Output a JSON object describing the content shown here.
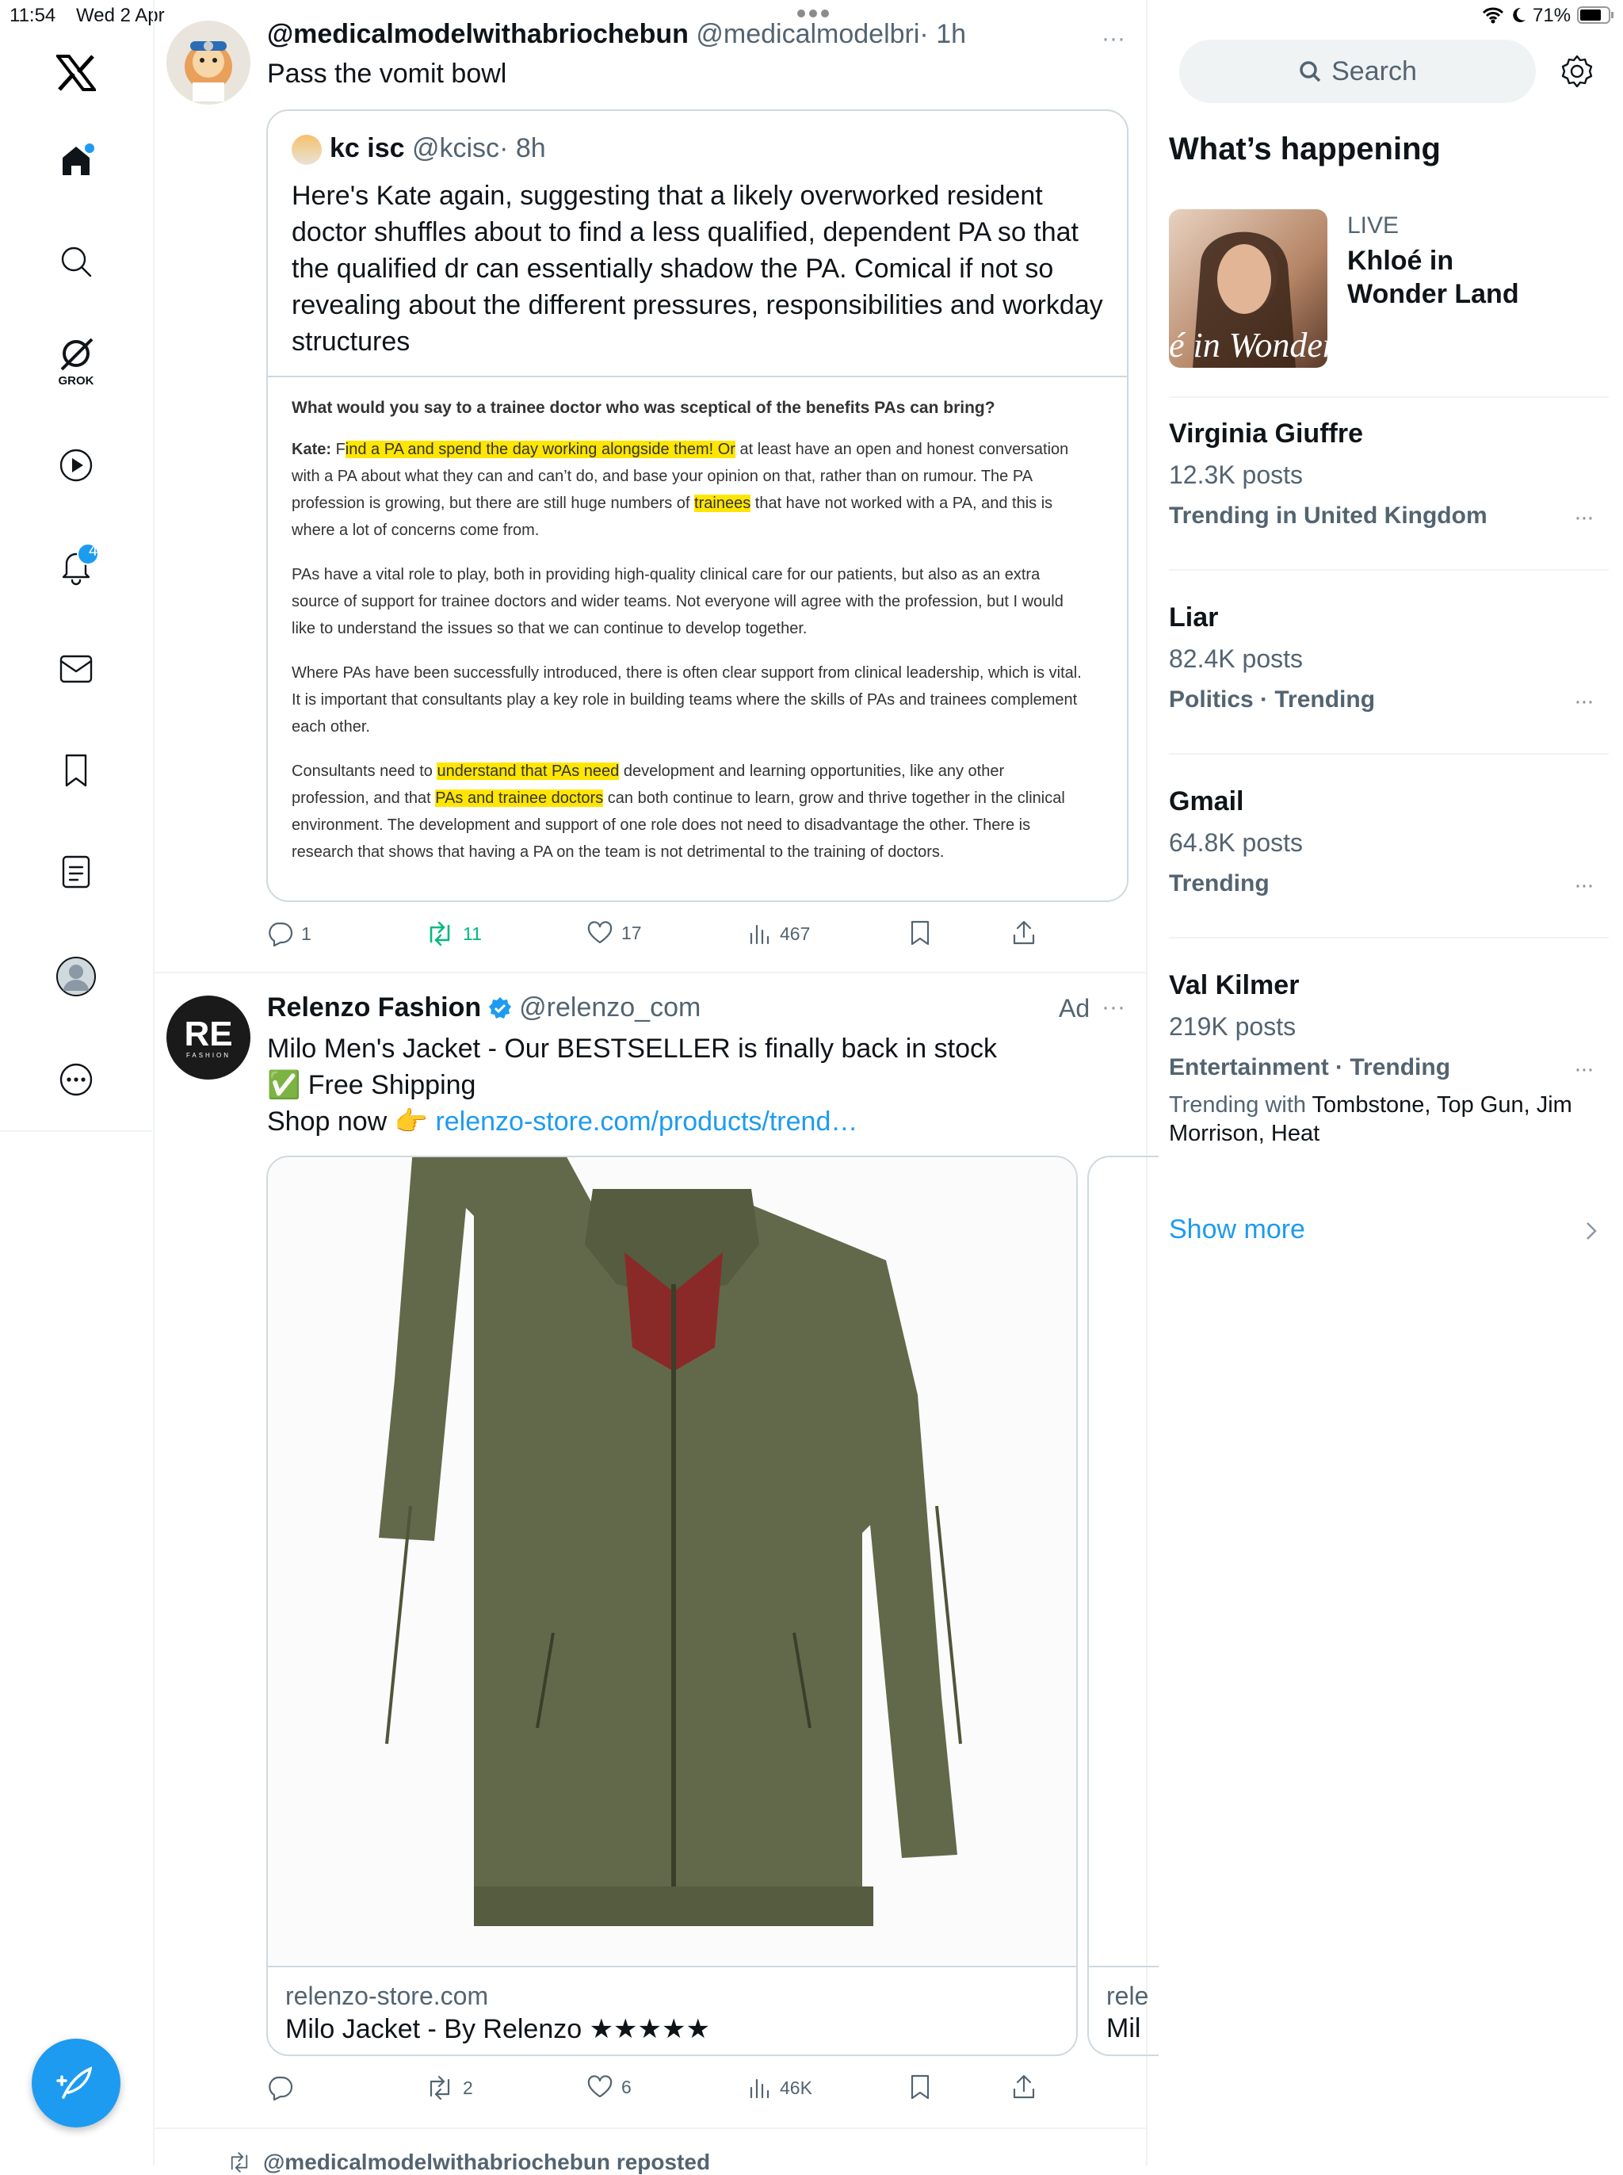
{
  "status": {
    "time": "11:54",
    "date": "Wed 2 Apr",
    "battery": "71%"
  },
  "nav": {
    "grok_label": "GROK",
    "notif_count": "4"
  },
  "tweet1": {
    "name": "@medicalmodelwithabriochebun",
    "handle": "@medicalmodelbri",
    "time": "· 1h",
    "text": "Pass the vomit bowl",
    "quote": {
      "name": "kc isc",
      "handle": "@kcisc",
      "time": "· 8h",
      "text": "Here's Kate again, suggesting that a likely overworked  resident doctor shuffles about to find a less qualified, dependent PA so that the qualified dr can essentially shadow the PA. Comical if not so revealing about the different pressures, responsibilities and workday structures",
      "doc": {
        "question": "What would you say to a trainee doctor who was sceptical of the benefits PAs can bring?",
        "p1_label": "Kate:",
        "p1_a": "F",
        "p1_hl1": "ind a PA and spend the day working alongside them! Or",
        "p1_b": " at least have an open and honest conversation with a PA about what they can and can’t do, and base your opinion on that, rather than on rumour. The PA profession is growing, but there are still huge numbers of ",
        "p1_hl2": "trainees",
        "p1_c": " that have not worked with a PA, and this is where a lot of concerns come from.",
        "p2": "PAs have a vital role to play, both in providing high-quality clinical care for our patients, but also as an extra source of support for trainee doctors and wider teams. Not everyone will agree with the profession, but I would like to understand the issues so that we can continue to develop together.",
        "p3": "Where PAs have been successfully introduced, there is often clear support from clinical leadership, which is vital. It is important that consultants play a key role in building teams where the skills of PAs and trainees complement each other.",
        "p4_a": "Consultants need to ",
        "p4_hl1": "understand that PAs need",
        "p4_b": " development and learning opportunities, like any other profession, and that ",
        "p4_hl2": "PAs and trainee doctors",
        "p4_c": " can both continue to learn, grow and thrive together in the clinical environment. The development and support of one role does not need to disadvantage the other. There is research that shows that having a PA on the team is not detrimental to the training of doctors."
      }
    },
    "stats": {
      "replies": "1",
      "reposts": "11",
      "likes": "17",
      "views": "467"
    }
  },
  "tweet2": {
    "name": "Relenzo Fashion",
    "handle": "@relenzo_com",
    "ad": "Ad",
    "avatar_text": "RE",
    "avatar_sub": "FASHION",
    "line1": "Milo Men's Jacket - Our BESTSELLER is finally back in stock",
    "line2": "✅ Free Shipping",
    "line3": "Shop now 👉 ",
    "link": "relenzo-store.com/products/trend…",
    "card": {
      "domain": "relenzo-store.com",
      "title": "Milo Jacket - By Relenzo ★★★★★",
      "domain2": "rele",
      "title2": "Mil"
    },
    "stats": {
      "reposts": "2",
      "likes": "6",
      "views": "46K"
    }
  },
  "tweet3": {
    "repost_line": "@medicalmodelwithabriochebun reposted"
  },
  "right": {
    "search_placeholder": "Search",
    "heading": "What’s happening",
    "live": {
      "label": "LIVE",
      "title": "Khloé in Wonder Land",
      "thumb_text": "é in Wonder L"
    },
    "trends": [
      {
        "name": "Virginia Giuffre",
        "count": "12.3K posts",
        "sub": "Trending in United Kingdom"
      },
      {
        "name": "Liar",
        "count": "82.4K posts",
        "sub": "Politics · Trending"
      },
      {
        "name": "Gmail",
        "count": "64.8K posts",
        "sub": "Trending"
      },
      {
        "name": "Val Kilmer",
        "count": "219K posts",
        "sub": "Entertainment · Trending",
        "with_label": "Trending with ",
        "with": "Tombstone, Top Gun, Jim Morrison, Heat"
      }
    ],
    "show_more": "Show more"
  },
  "colors": {
    "blue": "#1d9bf0",
    "green": "#00ba7c",
    "highlight": "#ffe600"
  }
}
